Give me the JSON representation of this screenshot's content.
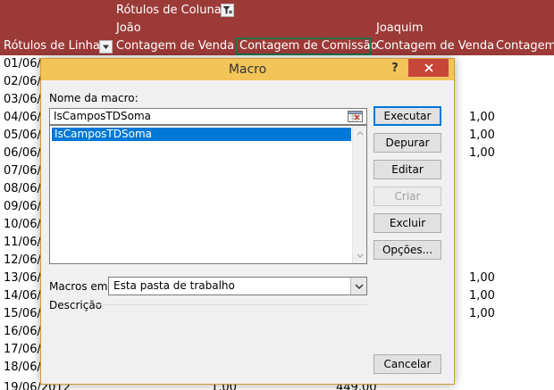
{
  "sheet": {
    "column_labels_header": "Rótulos de Coluna",
    "row_labels_header": "Rótulos de Linha",
    "groups": [
      "João",
      "Joaquim"
    ],
    "columns": [
      "Contagem de Venda",
      "Contagem de Comissão",
      "Contagem de Venda",
      "Contagem"
    ],
    "rows": [
      "01/06/",
      "02/06/",
      "03/06/",
      "04/06/",
      "05/06/",
      "06/06/",
      "07/06/",
      "08/06/",
      "09/06/",
      "10/06/",
      "11/06/",
      "12/06/",
      "13/06/",
      "14/06/",
      "15/06/",
      "16/06/",
      "17/06/",
      "18/06/",
      "19/06/2012"
    ],
    "values": [
      {
        "row": "04/06/",
        "value": "1,00"
      },
      {
        "row": "05/06/",
        "value": "1,00"
      },
      {
        "row": "06/06/",
        "value": "1,00"
      },
      {
        "row": "13/06/",
        "value": "1,00"
      },
      {
        "row": "14/06/",
        "value": "1,00"
      },
      {
        "row": "15/06/",
        "value": "1,00"
      }
    ],
    "last_row_partial": [
      "1,00",
      "449,00"
    ]
  },
  "dialog": {
    "title": "Macro",
    "help_label": "?",
    "macro_name_label": "Nome da macro:",
    "macro_name_value": "IsCamposTDSoma",
    "list_items": [
      "IsCamposTDSoma"
    ],
    "macros_in_label": "Macros em:",
    "macros_in_value": "Esta pasta de trabalho",
    "description_label": "Descrição",
    "buttons": {
      "run": "Executar",
      "step_into": "Depurar",
      "edit": "Editar",
      "create": "Criar",
      "delete": "Excluir",
      "options": "Opções...",
      "cancel": "Cancelar"
    }
  },
  "colors": {
    "header_bg": "#9b3a37",
    "titlebar_bg": "#f3c457",
    "close_bg": "#c7463a",
    "selection_bg": "#0078d7"
  }
}
